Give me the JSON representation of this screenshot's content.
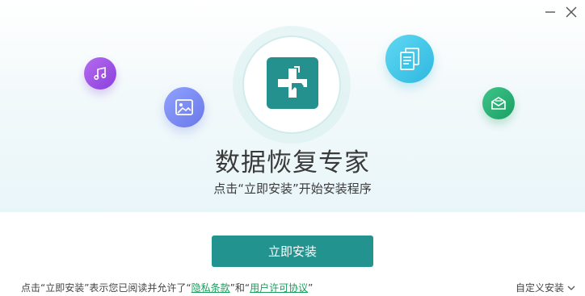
{
  "window": {
    "minimize_icon": "minimize-icon",
    "close_icon": "close-icon"
  },
  "hero": {
    "title": "数据恢复专家",
    "subtitle": "点击“立即安装”开始安装程序",
    "icons": [
      "music-icon",
      "photo-icon",
      "document-icon",
      "mail-icon",
      "app-logo-icon"
    ]
  },
  "install_button_label": "立即安装",
  "agreement": {
    "prefix": "点击“立即安装”表示您已阅读并允许了“",
    "privacy_link": "隐私条款",
    "middle": "”和“",
    "license_link": "用户许可协议",
    "suffix": "”"
  },
  "custom_install": {
    "label": "自定义安装",
    "icon": "chevron-down-icon"
  },
  "colors": {
    "accent": "#22938f",
    "link": "#1a9c5b"
  }
}
